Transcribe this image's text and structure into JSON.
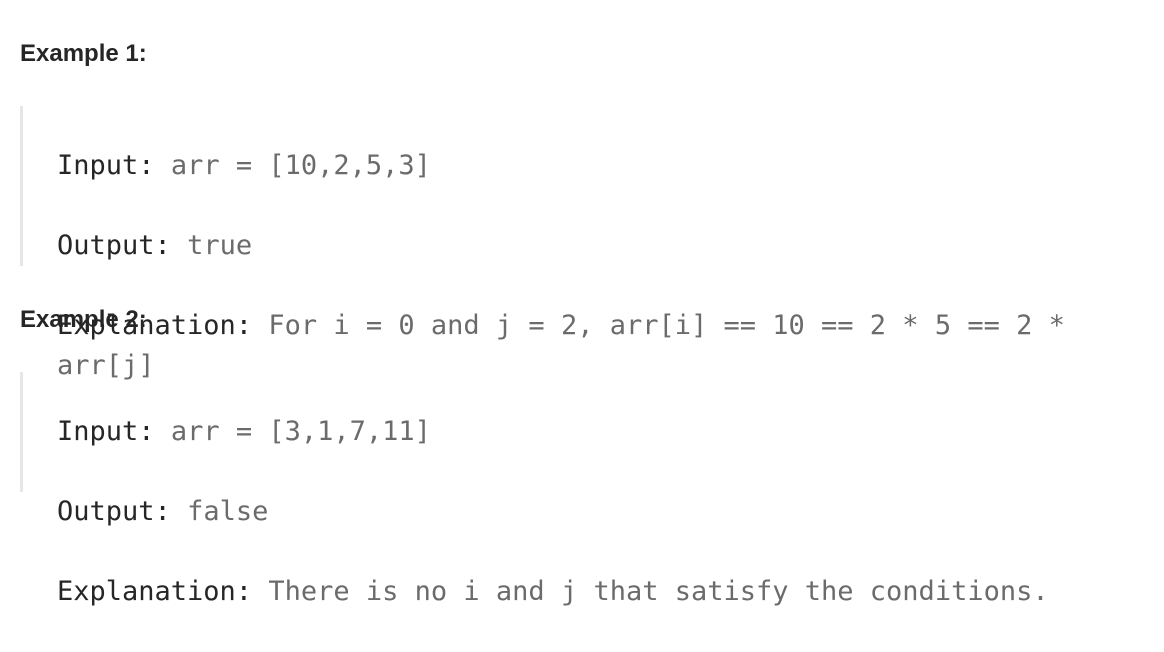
{
  "examples": [
    {
      "title": "Example 1:",
      "input_label": "Input:",
      "input": "arr = [10,2,5,3]",
      "output_label": "Output:",
      "output": "true",
      "explanation_label": "Explanation:",
      "explanation": "For i = 0 and j = 2, arr[i] == 10 == 2 * 5 == 2 * arr[j]"
    },
    {
      "title": "Example 2:",
      "input_label": "Input:",
      "input": "arr = [3,1,7,11]",
      "output_label": "Output:",
      "output": "false",
      "explanation_label": "Explanation:",
      "explanation": "There is no i and j that satisfy the conditions."
    }
  ]
}
